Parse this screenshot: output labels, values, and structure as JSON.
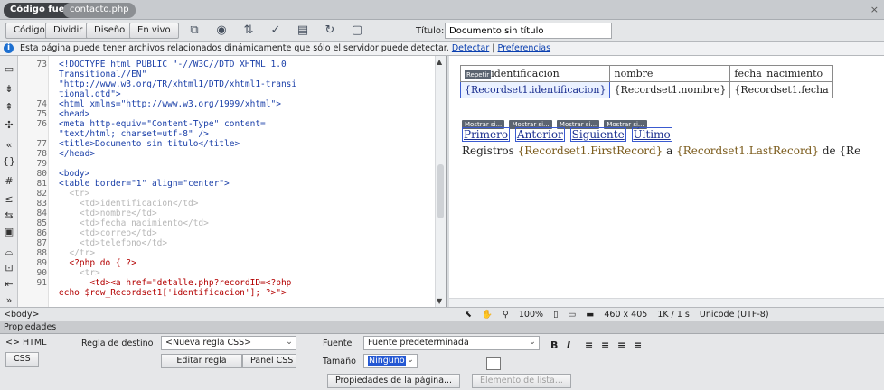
{
  "doc_tabs": {
    "source": "Código fuente",
    "file": "contacto.php",
    "close": "×"
  },
  "toolbar": {
    "code": "Código",
    "split": "Dividir",
    "design": "Diseño",
    "live": "En vivo",
    "title_label": "Título:",
    "title_value": "Documento sin título"
  },
  "info_bar": {
    "message": "Esta página puede tener archivos relacionados dinámicamente que sólo el servidor puede detectar.",
    "detect": "Detectar",
    "sep": "|",
    "prefs": "Preferencias"
  },
  "code_lines": [
    {
      "n": "73",
      "text": "<!DOCTYPE html PUBLIC \"-//W3C//DTD XHTML 1.0",
      "cls": "t-tag"
    },
    {
      "n": "",
      "text": "Transitional//EN\"",
      "cls": "t-tag"
    },
    {
      "n": "",
      "text": "\"http://www.w3.org/TR/xhtml1/DTD/xhtml1-transi",
      "cls": "t-tag"
    },
    {
      "n": "",
      "text": "tional.dtd\">",
      "cls": "t-tag"
    },
    {
      "n": "74",
      "text": "<html xmlns=\"http://www.w3.org/1999/xhtml\">",
      "cls": "t-tag"
    },
    {
      "n": "75",
      "text": "<head>",
      "cls": "t-tag"
    },
    {
      "n": "76",
      "text": "<meta http-equiv=\"Content-Type\" content=",
      "cls": "t-tag"
    },
    {
      "n": "",
      "text": "\"text/html; charset=utf-8\" />",
      "cls": "t-tag"
    },
    {
      "n": "77",
      "text": "<title>Documento sin titulo</title>",
      "cls": "t-tag"
    },
    {
      "n": "78",
      "text": "</head>",
      "cls": "t-tag"
    },
    {
      "n": "79",
      "text": "",
      "cls": "t-tag"
    },
    {
      "n": "80",
      "text": "<body>",
      "cls": "t-tag"
    },
    {
      "n": "81",
      "text": "<table border=\"1\" align=\"center\">",
      "cls": "t-tag"
    },
    {
      "n": "82",
      "text": "  <tr>",
      "cls": "t-td"
    },
    {
      "n": "83",
      "text": "    <td>identificacion</td>",
      "cls": "t-td"
    },
    {
      "n": "84",
      "text": "    <td>nombre</td>",
      "cls": "t-td"
    },
    {
      "n": "85",
      "text": "    <td>fecha_nacimiento</td>",
      "cls": "t-td"
    },
    {
      "n": "86",
      "text": "    <td>correo</td>",
      "cls": "t-td"
    },
    {
      "n": "87",
      "text": "    <td>telefono</td>",
      "cls": "t-td"
    },
    {
      "n": "88",
      "text": "  </tr>",
      "cls": "t-td"
    },
    {
      "n": "89",
      "text": "  <?php do { ?>",
      "cls": "t-php"
    },
    {
      "n": "90",
      "text": "    <tr>",
      "cls": "t-td"
    },
    {
      "n": "91",
      "text": "      <td><a href=\"detalle.php?recordID=<?php",
      "cls": "t-php"
    },
    {
      "n": "",
      "text": "echo $row_Recordset1['identificacion']; ?>\">",
      "cls": "t-php"
    }
  ],
  "design": {
    "headers": [
      "identificacion",
      "nombre",
      "fecha_nacimiento"
    ],
    "row": [
      "{Recordset1.identificacion}",
      "{Recordset1.nombre}",
      "{Recordset1.fecha"
    ],
    "recordset_tag": "Repetir",
    "nav_tags": [
      "Mostrar si...",
      "Mostrar si...",
      "Mostrar si...",
      "Mostrar si..."
    ],
    "nav_links": [
      "Primero",
      "Anterior",
      "Siguiente",
      "Último"
    ],
    "records_prefix": "Registros",
    "records_first": "{Recordset1.FirstRecord}",
    "records_mid": "a",
    "records_last": "{Recordset1.LastRecord}",
    "records_suffix": "de {Re"
  },
  "status": {
    "tag": "<body>",
    "zoom": "100%",
    "size": "460 x 405",
    "speed": "1K / 1 s",
    "encoding": "Unicode (UTF-8)"
  },
  "props": {
    "title": "Propiedades",
    "html": "<> HTML",
    "css": "CSS",
    "target_rule_label": "Regla de destino",
    "target_rule_value": "<Nueva regla CSS>",
    "edit_rule": "Editar regla",
    "css_panel": "Panel CSS",
    "font_label": "Fuente",
    "font_value": "Fuente predeterminada",
    "size_label": "Tamaño",
    "size_value": "Ninguno",
    "page_props": "Propiedades de la página...",
    "list_item": "Elemento de lista..."
  }
}
